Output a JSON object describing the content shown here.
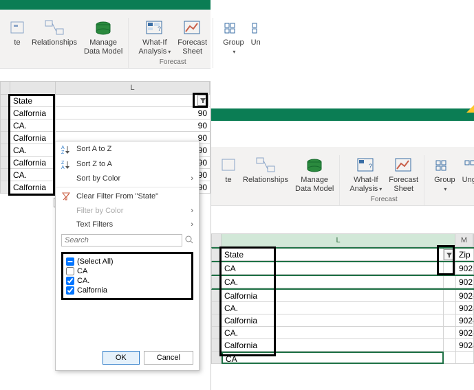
{
  "ribbon": {
    "duplicate_cut": "te",
    "relationships": "Relationships",
    "manage_data_model": "Manage\nData Model",
    "whatif": "What-If\nAnalysis",
    "forecast_sheet": "Forecast\nSheet",
    "group": "Group",
    "ungroup_cut": "Un",
    "ungroup_cut_r": "Ungro",
    "forecast_group": "Forecast"
  },
  "columns": {
    "L": "L",
    "M": "M"
  },
  "left_sheet": {
    "header": "State",
    "rows": [
      "Calfornia",
      "CA.",
      "Calfornia",
      "CA.",
      "Calfornia",
      "CA.",
      "Calfornia"
    ],
    "right_peek": [
      "90",
      "90",
      "90",
      "90",
      "90",
      "90",
      "90"
    ]
  },
  "right_sheet": {
    "header": "State",
    "header_right": "Zip",
    "rows": [
      "CA",
      "CA.",
      "Calfornia",
      "CA.",
      "Calfornia",
      "CA.",
      "Calfornia"
    ],
    "right_vals": [
      "902",
      "902",
      "9024",
      "9024",
      "9024",
      "9024",
      "9024"
    ],
    "tail": "CA"
  },
  "filter_menu": {
    "sort_asc": "Sort A to Z",
    "sort_desc": "Sort Z to A",
    "sort_color": "Sort by Color",
    "clear": "Clear Filter From \"State\"",
    "filter_color": "Filter by Color",
    "text_filters": "Text Filters",
    "search_ph": "Search",
    "select_all": "(Select All)",
    "items": [
      {
        "label": "CA",
        "checked": false
      },
      {
        "label": "CA.",
        "checked": true
      },
      {
        "label": "Calfornia",
        "checked": true
      }
    ],
    "ok": "OK",
    "cancel": "Cancel"
  }
}
